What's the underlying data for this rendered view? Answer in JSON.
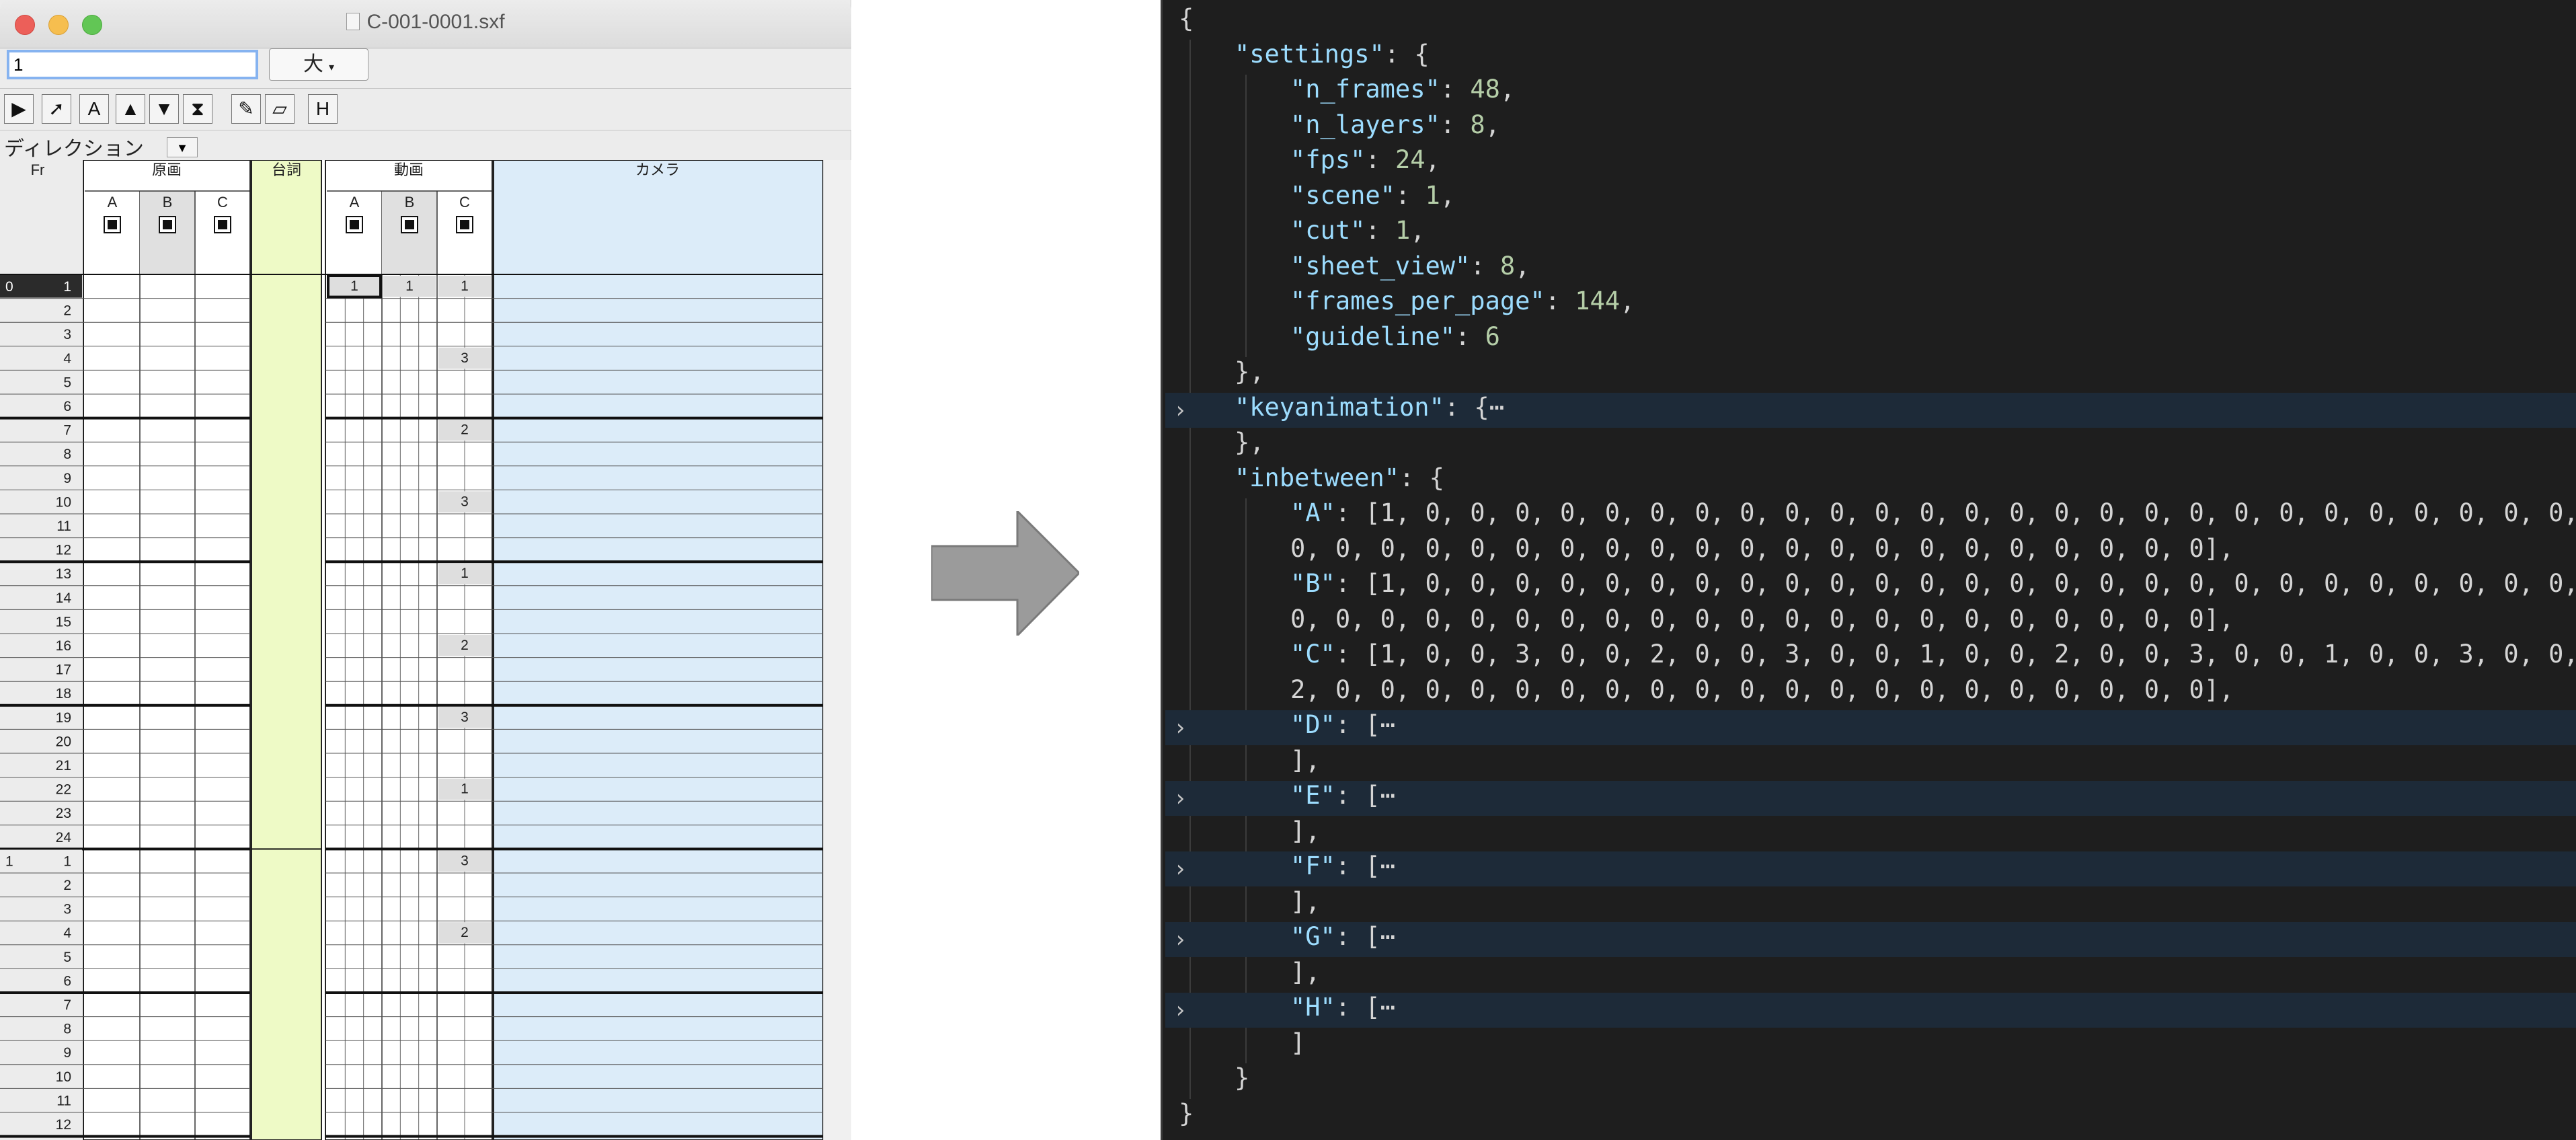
{
  "window": {
    "title": "C-001-0001.sxf",
    "frame_input_value": "1",
    "size_select": "大",
    "direction_label": "ディレクション"
  },
  "toolbar_icons": [
    "pointer-icon",
    "arrow-icon",
    "text-icon",
    "fill-up-icon",
    "fill-down-icon",
    "hourglass-icon",
    "pencil-icon",
    "eraser-icon",
    "h-bracket-icon"
  ],
  "sheet": {
    "fr_header": "Fr",
    "genga_header": "原画",
    "serifu_header": "台詞",
    "douga_header": "動画",
    "camera_header": "カメラ",
    "cols": [
      "A",
      "B",
      "C"
    ],
    "page_labels": [
      "0",
      "1"
    ],
    "c_column_values": {
      "1": "1",
      "4": "3",
      "7": "2",
      "10": "3",
      "13": "1",
      "16": "2",
      "19": "3",
      "22": "1",
      "25": "3",
      "28": "2"
    },
    "first_row_marks": [
      "1",
      "1",
      "1"
    ]
  },
  "colors": {
    "accent": "#86b3f0",
    "serifu": "#eefac6",
    "camera": "#dcecf9",
    "editor_bg": "#1e1e1e",
    "key": "#9cdcfe",
    "number": "#b5cea8"
  },
  "json_lines": [
    {
      "t": "{",
      "ind": 0
    },
    {
      "k": "settings",
      "v": ": {",
      "ind": 1
    },
    {
      "k": "n_frames",
      "v": ": 48,",
      "ind": 2,
      "num": true
    },
    {
      "k": "n_layers",
      "v": ": 8,",
      "ind": 2,
      "num": true
    },
    {
      "k": "fps",
      "v": ": 24,",
      "ind": 2,
      "num": true
    },
    {
      "k": "scene",
      "v": ": 1,",
      "ind": 2,
      "num": true
    },
    {
      "k": "cut",
      "v": ": 1,",
      "ind": 2,
      "num": true
    },
    {
      "k": "sheet_view",
      "v": ": 8,",
      "ind": 2,
      "num": true
    },
    {
      "k": "frames_per_page",
      "v": ": 144,",
      "ind": 2,
      "num": true
    },
    {
      "k": "guideline",
      "v": ": 6",
      "ind": 2,
      "num": true
    },
    {
      "t": "},",
      "ind": 1
    },
    {
      "k": "keyanimation",
      "v": ": {⋯",
      "ind": 1,
      "fold": true
    },
    {
      "t": "},",
      "ind": 1
    },
    {
      "k": "inbetween",
      "v": ": {",
      "ind": 1
    },
    {
      "k": "A",
      "v": ": [1, 0, 0, 0, 0, 0, 0, 0, 0, 0, 0, 0, 0, 0, 0, 0, 0, 0, 0, 0, 0, 0, 0, 0, 0, 0, 0, 0,",
      "ind": 2
    },
    {
      "t": "0, 0, 0, 0, 0, 0, 0, 0, 0, 0, 0, 0, 0, 0, 0, 0, 0, 0, 0, 0, 0],",
      "ind": 2
    },
    {
      "k": "B",
      "v": ": [1, 0, 0, 0, 0, 0, 0, 0, 0, 0, 0, 0, 0, 0, 0, 0, 0, 0, 0, 0, 0, 0, 0, 0, 0, 0, 0, 0,",
      "ind": 2
    },
    {
      "t": "0, 0, 0, 0, 0, 0, 0, 0, 0, 0, 0, 0, 0, 0, 0, 0, 0, 0, 0, 0, 0],",
      "ind": 2
    },
    {
      "k": "C",
      "v": ": [1, 0, 0, 3, 0, 0, 2, 0, 0, 3, 0, 0, 1, 0, 0, 2, 0, 0, 3, 0, 0, 1, 0, 0, 3, 0, 0,",
      "ind": 2
    },
    {
      "t": "2, 0, 0, 0, 0, 0, 0, 0, 0, 0, 0, 0, 0, 0, 0, 0, 0, 0, 0, 0, 0],",
      "ind": 2
    },
    {
      "k": "D",
      "v": ": [⋯",
      "ind": 2,
      "fold": true
    },
    {
      "t": "],",
      "ind": 2
    },
    {
      "k": "E",
      "v": ": [⋯",
      "ind": 2,
      "fold": true
    },
    {
      "t": "],",
      "ind": 2
    },
    {
      "k": "F",
      "v": ": [⋯",
      "ind": 2,
      "fold": true
    },
    {
      "t": "],",
      "ind": 2
    },
    {
      "k": "G",
      "v": ": [⋯",
      "ind": 2,
      "fold": true
    },
    {
      "t": "],",
      "ind": 2
    },
    {
      "k": "H",
      "v": ": [⋯",
      "ind": 2,
      "fold": true
    },
    {
      "t": "]",
      "ind": 2
    },
    {
      "t": "}",
      "ind": 1
    },
    {
      "t": "}",
      "ind": 0
    }
  ]
}
